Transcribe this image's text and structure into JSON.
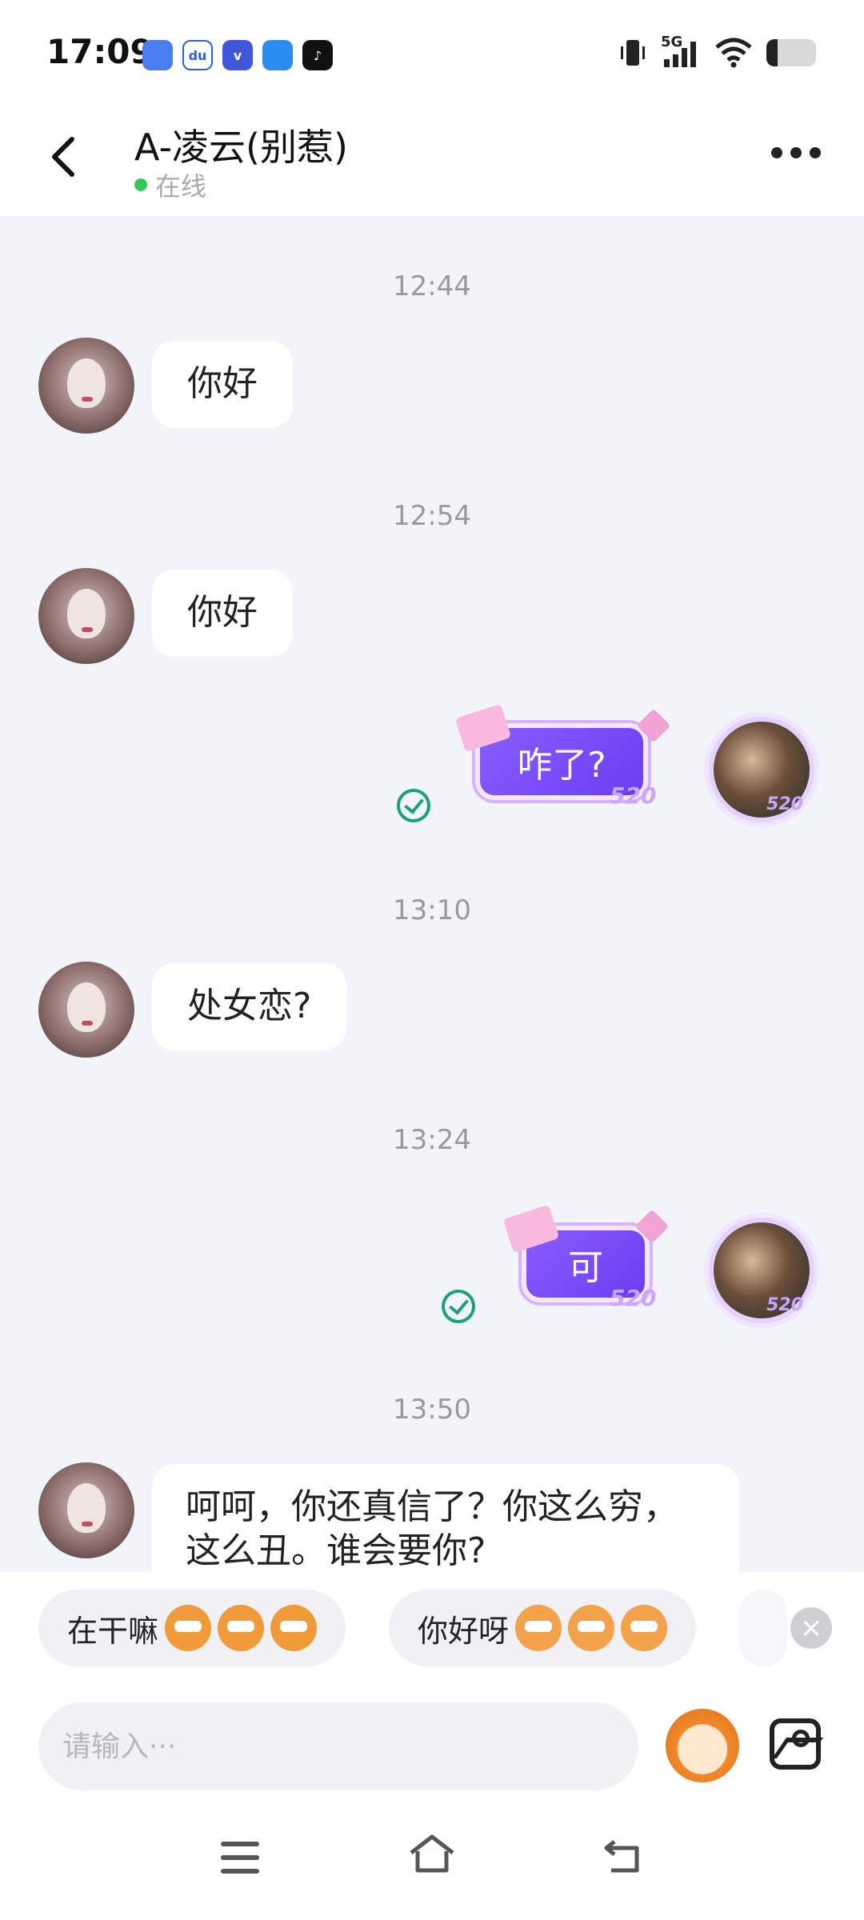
{
  "status_bar": {
    "time": "17:09",
    "network": "5G",
    "battery_level": 0.22
  },
  "header": {
    "contact_name": "A-凌云(别惹)",
    "presence": "在线"
  },
  "messages": [
    {
      "type": "time",
      "text": "12:44"
    },
    {
      "type": "in",
      "text": "你好"
    },
    {
      "type": "time",
      "text": "12:54"
    },
    {
      "type": "in",
      "text": "你好"
    },
    {
      "type": "out",
      "text": "咋了?",
      "badge": "520"
    },
    {
      "type": "time",
      "text": "13:10"
    },
    {
      "type": "in",
      "text": "处女恋?"
    },
    {
      "type": "time",
      "text": "13:24"
    },
    {
      "type": "out",
      "text": "可",
      "badge": "520"
    },
    {
      "type": "time",
      "text": "13:50"
    },
    {
      "type": "in",
      "text": "呵呵，你还真信了？你这么穷，\n这么丑。谁会要你?"
    }
  ],
  "my_avatar_badge": "520",
  "quick_replies": [
    {
      "label": "在干嘛"
    },
    {
      "label": "你好呀"
    }
  ],
  "input": {
    "placeholder": "请输入···"
  },
  "colors": {
    "accent_purple": "#7a4dff",
    "online_green": "#34c759",
    "read_green": "#1aa179"
  },
  "icons": [
    "back-arrow-icon",
    "more-icon",
    "read-check-icon",
    "close-icon",
    "mascot-emoji-icon",
    "gallery-icon",
    "nav-menu-icon",
    "nav-home-icon",
    "nav-back-icon"
  ]
}
